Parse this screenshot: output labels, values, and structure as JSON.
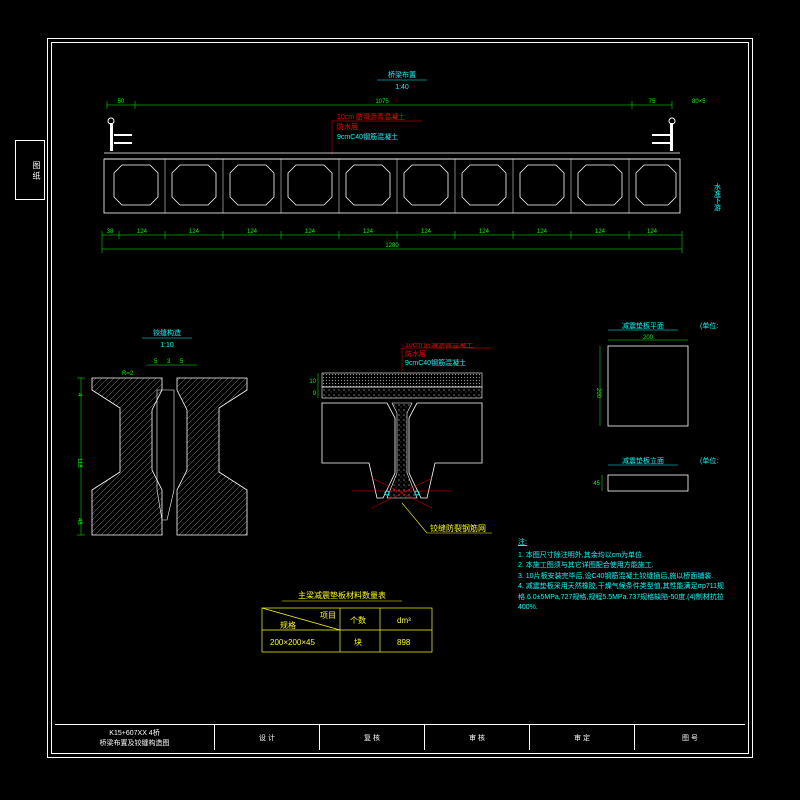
{
  "sidebar": {
    "label": "图 纸"
  },
  "main_view": {
    "title": "桥梁布置",
    "scale": "1:40",
    "layer_callouts": [
      "10cm 防滑沥青混凝土",
      "防水层",
      "9cmC40钢筋混凝土"
    ],
    "dims_top": {
      "left": "50",
      "center": "1075",
      "right": "75",
      "far": "80×5"
    },
    "dims_bottom": {
      "edge": "38",
      "span": "124",
      "total": "1280"
    },
    "right_label": "水准下游"
  },
  "joint_view": {
    "title": "铰缝构造",
    "scale": "1:10",
    "dims": [
      "5",
      "3",
      "5",
      "R=2",
      "118",
      "4",
      "48"
    ]
  },
  "deck_detail": {
    "layers": [
      "10cm 防滑沥青混凝土",
      "防水层",
      "9cmC40钢筋混凝土"
    ],
    "dims": [
      "10",
      "9"
    ],
    "callout": "铰缝防裂钢筋网"
  },
  "bearing_plan": {
    "title": "减震垫板平面",
    "unit": "(单位:mm)",
    "dim_w": "200",
    "dim_h": "200"
  },
  "bearing_elev": {
    "title": "减震垫板立面",
    "unit": "(单位:mm)",
    "dim_h": "45"
  },
  "material_table": {
    "title": "主梁减震垫板材料数量表",
    "headers": [
      "规格",
      "项目",
      "个数",
      "dm³"
    ],
    "row": [
      "200×200×45",
      "块",
      "898"
    ]
  },
  "notes": {
    "header": "注:",
    "lines": [
      "1. 本图尺寸除注明外,其余均以cm为单位.",
      "2. 本施工图须与其它详图配合使用方能施工.",
      "3. 10片板安装完毕后,设C40钢筋混凝土铰缝插后,施以桥面铺装.",
      "4. 减震垫板采用天然橡胶,干燥气候条件类型值,其性能满足σp711规格.6.0±5MPa,727规格,规程5.5MPa.737规格缺陷-50度.(4)制材抗拉400%."
    ]
  },
  "titleblock": {
    "project": "K15+607XX 4桥",
    "sheet": "桥梁布置及铰缝构造图",
    "labels": [
      "设 计",
      "复 核",
      "审 核",
      "审 定",
      "图 号"
    ]
  }
}
